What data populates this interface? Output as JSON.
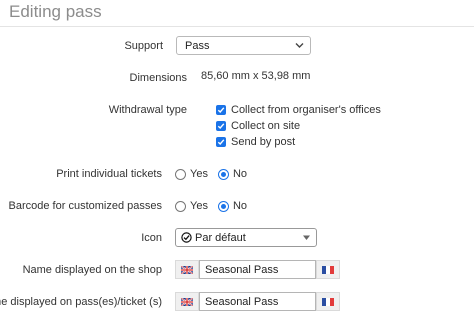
{
  "page": {
    "title": "Editing pass"
  },
  "support": {
    "label": "Support",
    "value": "Pass"
  },
  "dimensions": {
    "label": "Dimensions",
    "value": "85,60 mm x 53,98 mm"
  },
  "withdrawal": {
    "label": "Withdrawal type",
    "options": [
      {
        "label": "Collect from organiser's offices",
        "checked": true
      },
      {
        "label": "Collect on site",
        "checked": true
      },
      {
        "label": "Send by post",
        "checked": true
      }
    ]
  },
  "print_individual": {
    "label": "Print individual tickets",
    "yes": "Yes",
    "no": "No",
    "selected": "No"
  },
  "barcode": {
    "label": "Barcode for customized passes",
    "yes": "Yes",
    "no": "No",
    "selected": "No"
  },
  "icon": {
    "label": "Icon",
    "value": "Par défaut",
    "icon_name": "check-circle-icon"
  },
  "shop_name": {
    "label": "Name displayed on the shop",
    "value": "Seasonal Pass",
    "flag_left": "uk-flag-icon",
    "flag_right": "fr-flag-icon"
  },
  "pass_name": {
    "label": "Name displayed on pass(es)/ticket (s)",
    "value": "Seasonal Pass",
    "flag_left": "uk-flag-icon",
    "flag_right": "fr-flag-icon"
  },
  "colors": {
    "accent": "#1a73e8"
  }
}
